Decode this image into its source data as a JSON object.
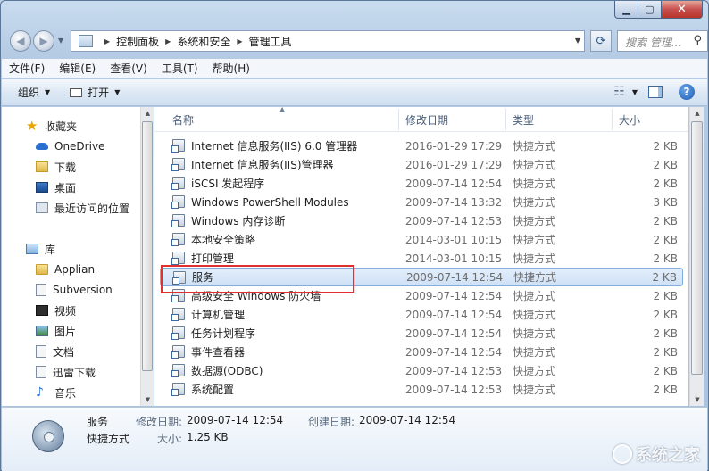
{
  "window": {
    "caption_minimize": "▁",
    "caption_maximize": "▢",
    "caption_close": "✕"
  },
  "address_bar": {
    "crumbs": [
      "控制面板",
      "系统和安全",
      "管理工具"
    ],
    "search_placeholder": "搜索 管理..."
  },
  "menu": [
    "文件(F)",
    "编辑(E)",
    "查看(V)",
    "工具(T)",
    "帮助(H)"
  ],
  "toolbar": {
    "organize": "组织",
    "open": "打开"
  },
  "nav_pane": {
    "favorites": "收藏夹",
    "items": [
      "OneDrive",
      "下载",
      "桌面",
      "最近访问的位置"
    ],
    "library": "库",
    "library_items": [
      "Applian",
      "Subversion",
      "视频",
      "图片",
      "文档",
      "迅雷下载",
      "音乐"
    ]
  },
  "columns": {
    "name": "名称",
    "date": "修改日期",
    "type": "类型",
    "size": "大小"
  },
  "files": [
    {
      "name": "Internet 信息服务(IIS) 6.0 管理器",
      "date": "2016-01-29 17:29",
      "type": "快捷方式",
      "size": "2 KB"
    },
    {
      "name": "Internet 信息服务(IIS)管理器",
      "date": "2016-01-29 17:29",
      "type": "快捷方式",
      "size": "2 KB"
    },
    {
      "name": "iSCSI 发起程序",
      "date": "2009-07-14 12:54",
      "type": "快捷方式",
      "size": "2 KB"
    },
    {
      "name": "Windows PowerShell Modules",
      "date": "2009-07-14 13:32",
      "type": "快捷方式",
      "size": "3 KB"
    },
    {
      "name": "Windows 内存诊断",
      "date": "2009-07-14 12:53",
      "type": "快捷方式",
      "size": "2 KB"
    },
    {
      "name": "本地安全策略",
      "date": "2014-03-01 10:15",
      "type": "快捷方式",
      "size": "2 KB"
    },
    {
      "name": "打印管理",
      "date": "2014-03-01 10:15",
      "type": "快捷方式",
      "size": "2 KB"
    },
    {
      "name": "服务",
      "date": "2009-07-14 12:54",
      "type": "快捷方式",
      "size": "2 KB"
    },
    {
      "name": "高级安全 Windows 防火墙",
      "date": "2009-07-14 12:54",
      "type": "快捷方式",
      "size": "2 KB"
    },
    {
      "name": "计算机管理",
      "date": "2009-07-14 12:54",
      "type": "快捷方式",
      "size": "2 KB"
    },
    {
      "name": "任务计划程序",
      "date": "2009-07-14 12:54",
      "type": "快捷方式",
      "size": "2 KB"
    },
    {
      "name": "事件查看器",
      "date": "2009-07-14 12:54",
      "type": "快捷方式",
      "size": "2 KB"
    },
    {
      "name": "数据源(ODBC)",
      "date": "2009-07-14 12:53",
      "type": "快捷方式",
      "size": "2 KB"
    },
    {
      "name": "系统配置",
      "date": "2009-07-14 12:53",
      "type": "快捷方式",
      "size": "2 KB"
    }
  ],
  "selected_index": 7,
  "details": {
    "name": "服务",
    "type": "快捷方式",
    "modified_label": "修改日期:",
    "modified": "2009-07-14 12:54",
    "created_label": "创建日期:",
    "created": "2009-07-14 12:54",
    "size_label": "大小:",
    "size": "1.25 KB"
  },
  "watermark": "系统之家",
  "colors": {
    "selection": "#cfe1f6",
    "highlight_box": "#e03030",
    "accent": "#2a6fd0"
  }
}
